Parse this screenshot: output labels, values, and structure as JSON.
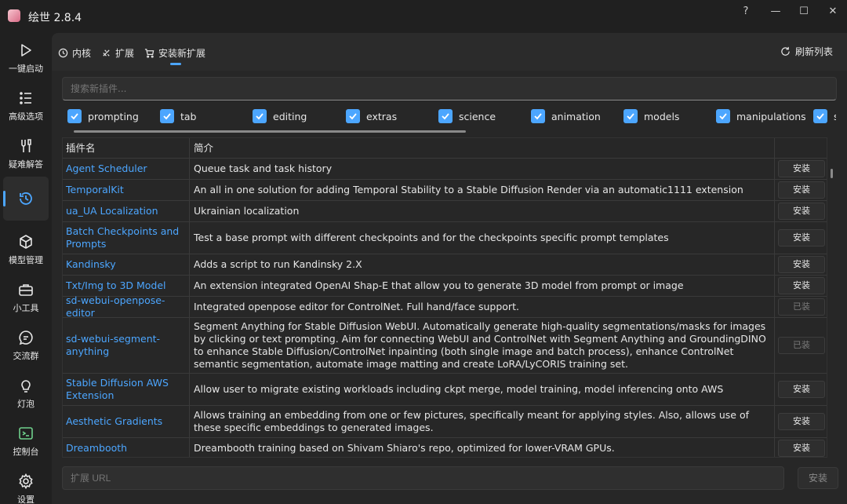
{
  "app": {
    "title": "绘世 2.8.4"
  },
  "window": {
    "help": "?",
    "minimize": "—",
    "maximize": "☐",
    "close": "✕"
  },
  "sidebar": {
    "items": [
      {
        "label": "一键启动",
        "icon": "play-icon"
      },
      {
        "label": "高级选项",
        "icon": "list-icon"
      },
      {
        "label": "疑难解答",
        "icon": "tools-icon"
      },
      {
        "label": "",
        "icon": "history-icon",
        "active": true
      },
      {
        "label": "模型管理",
        "icon": "cube-icon"
      },
      {
        "label": "小工具",
        "icon": "toolbox-icon"
      },
      {
        "label": "交流群",
        "icon": "chat-icon"
      },
      {
        "label": "灯泡",
        "icon": "bulb-icon"
      },
      {
        "label": "控制台",
        "icon": "terminal-icon"
      },
      {
        "label": "设置",
        "icon": "gear-icon"
      }
    ]
  },
  "tabs": [
    {
      "label": "内核",
      "icon": "history-icon"
    },
    {
      "label": "扩展",
      "icon": "puzzle-icon"
    },
    {
      "label": "安装新扩展",
      "icon": "cart-icon",
      "active": true
    }
  ],
  "refresh_label": "刷新列表",
  "search": {
    "placeholder": "搜索新插件..."
  },
  "filters": [
    "prompting",
    "tab",
    "editing",
    "extras",
    "science",
    "animation",
    "models",
    "manipulations",
    "s"
  ],
  "table": {
    "headers": [
      "插件名",
      "简介",
      ""
    ],
    "rows": [
      {
        "name": "Agent Scheduler",
        "desc": "Queue task and task history",
        "action": "安装",
        "installed": false
      },
      {
        "name": "TemporalKit",
        "desc": "An all in one solution for adding Temporal Stability to a Stable Diffusion Render via an automatic1111 extension",
        "action": "安装",
        "installed": false
      },
      {
        "name": "ua_UA Localization",
        "desc": "Ukrainian localization",
        "action": "安装",
        "installed": false
      },
      {
        "name": "Batch Checkpoints and Prompts",
        "desc": "Test a base prompt with different checkpoints and for the checkpoints specific prompt templates",
        "action": "安装",
        "installed": false
      },
      {
        "name": "Kandinsky",
        "desc": "Adds a script to run Kandinsky 2.X",
        "action": "安装",
        "installed": false
      },
      {
        "name": "Txt/Img to 3D Model",
        "desc": "An extension integrated OpenAI Shap-E that allow you to generate 3D model from prompt or image",
        "action": "安装",
        "installed": false
      },
      {
        "name": "sd-webui-openpose-editor",
        "desc": "Integrated openpose editor for ControlNet. Full hand/face support.",
        "action": "已装",
        "installed": true
      },
      {
        "name": "sd-webui-segment-anything",
        "desc": "Segment Anything for Stable Diffusion WebUI. Automatically generate high-quality segmentations/masks for images by clicking or text prompting. Aim for connecting WebUI and ControlNet with Segment Anything and GroundingDINO to enhance Stable Diffusion/ControlNet inpainting (both single image and batch process), enhance ControlNet semantic segmentation, automate image matting and create LoRA/LyCORIS training set.",
        "action": "已装",
        "installed": true
      },
      {
        "name": "Stable Diffusion AWS Extension",
        "desc": "Allow user to migrate existing workloads including ckpt merge, model training, model inferencing onto AWS",
        "action": "安装",
        "installed": false
      },
      {
        "name": "Aesthetic Gradients",
        "desc": "Allows training an embedding from one or few pictures, specifically meant for applying styles. Also, allows use of these specific embeddings to generated images.",
        "action": "安装",
        "installed": false
      },
      {
        "name": "Dreambooth",
        "desc": "Dreambooth training based on Shivam Shiaro's repo, optimized for lower-VRAM GPUs.",
        "action": "安装",
        "installed": false
      }
    ]
  },
  "url": {
    "placeholder": "扩展 URL",
    "button": "安装"
  }
}
